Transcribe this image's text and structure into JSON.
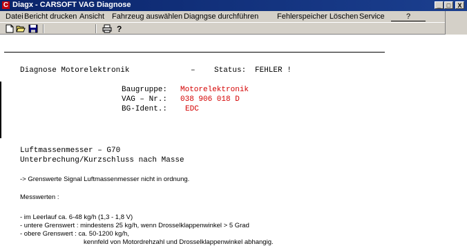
{
  "window": {
    "title": "Diagx - CARSOFT VAG Diagnose",
    "app_icon_letter": "C",
    "controls": [
      "_",
      "□",
      "X"
    ]
  },
  "menu": [
    "Datei",
    "Bericht drucken",
    "Ansicht",
    "Fahrzeug auswählen",
    "Diagngse durchführen",
    "Fehlerspeicher Löschen",
    "Service",
    "?"
  ],
  "toolbar": [
    "new-icon",
    "open-icon",
    "save-icon",
    "print-icon",
    "help-icon"
  ],
  "report": {
    "heading": "Diagnose Motorelektronik",
    "dash": "–",
    "status_label": "Status:",
    "status_value": "FEHLER !",
    "fields": [
      {
        "label": "Baugruppe:",
        "value": "Motorelektronik"
      },
      {
        "label": "VAG – Nr.:",
        "value": "038 906 018 D"
      },
      {
        "label": "BG-Ident.:",
        "value": "EDC"
      }
    ],
    "component": "Luftmassenmesser – G70",
    "fault": "Unterbrechung/Kurzschluss nach Masse",
    "note": "-> Grenswerte Signal Luftmassenmesser nicht in ordnung.",
    "measure_title": "Messwerten :",
    "measure_lines": [
      "- im Leerlauf ca. 6-48 kg/h (1,3 - 1,8 V)",
      "- untere Grenswert : mindestens 25 kg/h, wenn Drosselklappenwinkel > 5 Grad",
      "- obere Grenswert : ca. 50-1200 kg/h,",
      "kennfeld von Motordrehzahl und Drosselklappenwinkel abhangig."
    ]
  },
  "colors": {
    "title_bg": "#0a246a",
    "value_red": "#d40000"
  }
}
